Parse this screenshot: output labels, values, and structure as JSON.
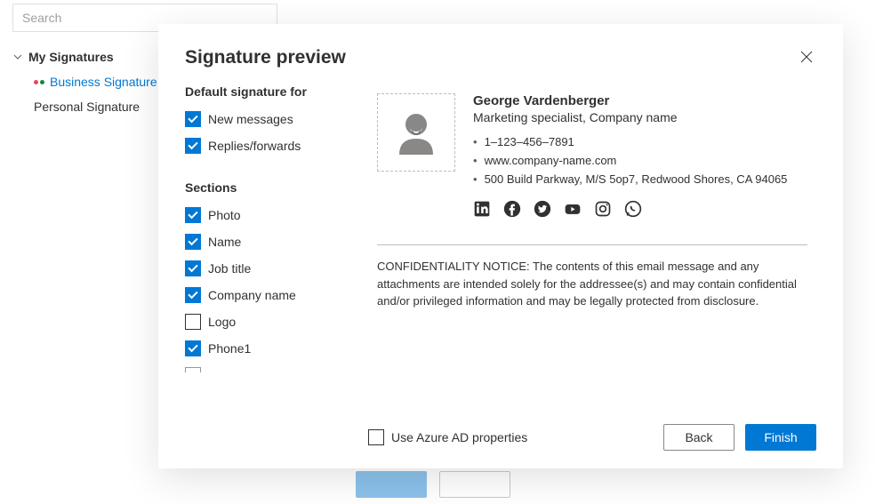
{
  "sidebar": {
    "search_placeholder": "Search",
    "tree_title": "My Signatures",
    "items": [
      {
        "label": "Business Signature",
        "active": true
      },
      {
        "label": "Personal Signature",
        "active": false
      }
    ]
  },
  "modal": {
    "title": "Signature preview",
    "default_for_title": "Default signature for",
    "default_for": [
      {
        "label": "New messages",
        "checked": true
      },
      {
        "label": "Replies/forwards",
        "checked": true
      }
    ],
    "sections_title": "Sections",
    "sections": [
      {
        "label": "Photo",
        "checked": true
      },
      {
        "label": "Name",
        "checked": true
      },
      {
        "label": "Job title",
        "checked": true
      },
      {
        "label": "Company name",
        "checked": true
      },
      {
        "label": "Logo",
        "checked": false
      },
      {
        "label": "Phone1",
        "checked": true
      }
    ],
    "preview": {
      "name": "George Vardenberger",
      "role": "Marketing specialist, Company name",
      "phone": "1–123–456–7891",
      "website": "www.company-name.com",
      "address": "500 Build Parkway, M/S 5op7, Redwood Shores, CA 94065",
      "social": [
        "linkedin",
        "facebook",
        "twitter",
        "youtube",
        "instagram",
        "whatsapp"
      ],
      "notice": "CONFIDENTIALITY NOTICE: The contents of this email message and any attachments are intended solely for the addressee(s) and may contain confidential and/or privileged information and may be legally protected from disclosure."
    },
    "footer": {
      "azure_ad_label": "Use Azure AD properties",
      "azure_ad_checked": false,
      "back_label": "Back",
      "finish_label": "Finish"
    }
  }
}
